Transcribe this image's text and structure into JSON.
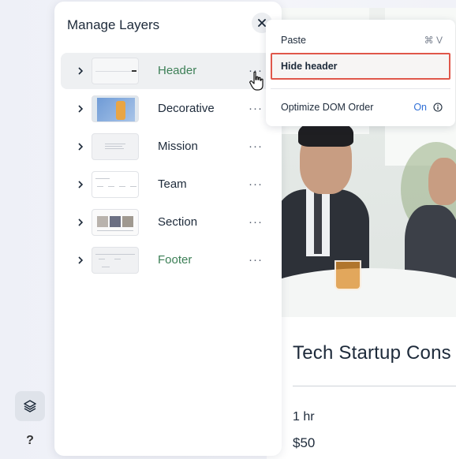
{
  "panel": {
    "title": "Manage Layers",
    "layers": [
      {
        "label": "Header",
        "state": "selected",
        "color": "#3c7f56"
      },
      {
        "label": "Decorative"
      },
      {
        "label": "Mission"
      },
      {
        "label": "Team"
      },
      {
        "label": "Section"
      },
      {
        "label": "Footer",
        "color": "#3c7f56"
      }
    ]
  },
  "context_menu": {
    "paste_label": "Paste",
    "paste_shortcut": "⌘ V",
    "hide_label": "Hide header",
    "optimize_label": "Optimize DOM Order",
    "optimize_value": "On"
  },
  "preview": {
    "title": "Tech Startup Cons",
    "duration": "1 hr",
    "price": "$50"
  },
  "rail": {
    "help_label": "?"
  },
  "colors": {
    "accent_green": "#3c7f56",
    "highlight_red": "#e0574a",
    "link_blue": "#2f6fd6"
  }
}
